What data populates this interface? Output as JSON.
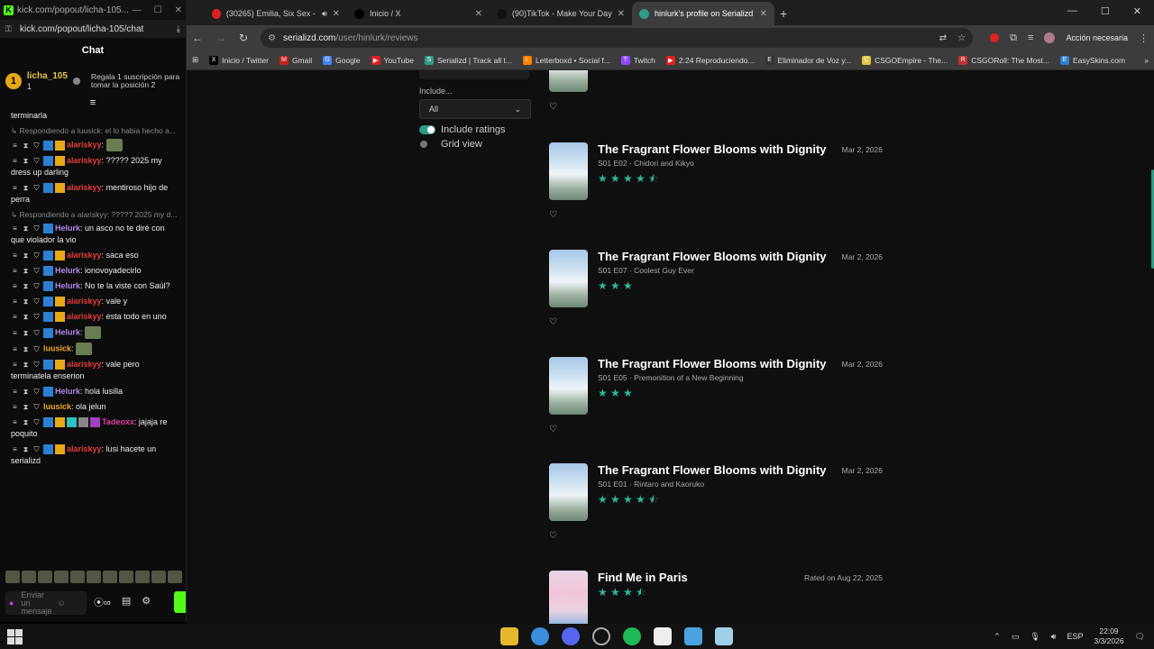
{
  "kick": {
    "window_title": "kick.com/popout/licha-105...",
    "url": "kick.com/popout/licha-105/chat",
    "chat_title": "Chat",
    "gift": {
      "rank": "1",
      "name": "licha_105",
      "count": "1",
      "message": "Regala 1 suscripción para tomar la posición 2"
    },
    "truncated_top": "terminarla",
    "messages": [
      {
        "reply": "Respondiendo a luusick: el lo habia hecho a...",
        "user": "alariskyy",
        "ucls": "u-red",
        "text": "",
        "emote": true,
        "badges": "full"
      },
      {
        "reply": "",
        "user": "alariskyy",
        "ucls": "u-red",
        "text": "????? 2025 my dress up darling",
        "badges": "full"
      },
      {
        "reply": "",
        "user": "alariskyy",
        "ucls": "u-red",
        "text": "mentiroso hijo de perra",
        "badges": "full"
      },
      {
        "reply": "Respondiendo a alariskyy: ????? 2025 my d...",
        "user": "Helurk",
        "ucls": "u-purp",
        "text": "un asco no te diré con que violador la vio",
        "badges": "blue"
      },
      {
        "reply": "",
        "user": "alariskyy",
        "ucls": "u-red",
        "text": "saca eso",
        "badges": "full"
      },
      {
        "reply": "",
        "user": "Helurk",
        "ucls": "u-purp",
        "text": "ionovoyadecirlo",
        "badges": "blue"
      },
      {
        "reply": "",
        "user": "Helurk",
        "ucls": "u-purp",
        "text": "No te la viste con Saúl?",
        "badges": "blue"
      },
      {
        "reply": "",
        "user": "alariskyy",
        "ucls": "u-red",
        "text": "vale y",
        "badges": "full"
      },
      {
        "reply": "",
        "user": "alariskyy",
        "ucls": "u-red",
        "text": "esta todo en uno",
        "badges": "full"
      },
      {
        "reply": "",
        "user": "Helurk",
        "ucls": "u-purp",
        "text": "",
        "emote": true,
        "badges": "blue"
      },
      {
        "reply": "",
        "user": "luusick",
        "ucls": "u-or",
        "text": "",
        "emote": true,
        "badges": "none"
      },
      {
        "reply": "",
        "user": "alariskyy",
        "ucls": "u-red",
        "text": "vale pero terminatela enserion",
        "badges": "full"
      },
      {
        "reply": "",
        "user": "Helurk",
        "ucls": "u-purp",
        "text": "hola lusilla",
        "badges": "blue"
      },
      {
        "reply": "",
        "user": "luusick",
        "ucls": "u-or",
        "text": "ola jelun",
        "badges": "none"
      },
      {
        "reply": "",
        "user": "Tadeoxx",
        "ucls": "u-pk",
        "text": "jajaja re poquito",
        "badges": "many"
      },
      {
        "reply": "",
        "user": "alariskyy",
        "ucls": "u-red",
        "text": "lusi hacete un serializd",
        "badges": "full"
      }
    ],
    "input_placeholder": "Enviar un mensaje"
  },
  "browser": {
    "tabs": [
      {
        "label": "(30265) Emilia, Six Sex - pa",
        "icon": "youtube-icon",
        "color": "#e02020"
      },
      {
        "label": "Inicio / X",
        "icon": "x-icon",
        "color": "#000000"
      },
      {
        "label": "(90)TikTok - Make Your Day",
        "icon": "tiktok-icon",
        "color": "#111111"
      },
      {
        "label": "hinlurk's profile on Serializd",
        "icon": "serializd-icon",
        "color": "#2e9c87"
      }
    ],
    "url_domain": "serializd.com",
    "url_path": "/user/hinlurk/reviews",
    "action_label": "Acción necesaria",
    "bookmarks": [
      {
        "label": "Inicio / Twitter",
        "color": "#000000",
        "g": "X"
      },
      {
        "label": "Gmail",
        "color": "#c5221f",
        "g": "M"
      },
      {
        "label": "Google",
        "color": "#4285f4",
        "g": "G"
      },
      {
        "label": "YouTube",
        "color": "#e02020",
        "g": "▶"
      },
      {
        "label": "Serializd | Track all t...",
        "color": "#2e9c87",
        "g": "S"
      },
      {
        "label": "Letterboxd • Social f...",
        "color": "#ff8000",
        "g": "L"
      },
      {
        "label": "Twitch",
        "color": "#9146ff",
        "g": "T"
      },
      {
        "label": "2:24 Reproduciendo...",
        "color": "#e02020",
        "g": "▶"
      },
      {
        "label": "Eliminador de Voz y...",
        "color": "#333333",
        "g": "E"
      },
      {
        "label": "CSGOEmpire - The...",
        "color": "#e6c347",
        "g": "C"
      },
      {
        "label": "CSGORoll: The Most...",
        "color": "#c03030",
        "g": "R"
      },
      {
        "label": "EasySkins.com",
        "color": "#2d7fd3",
        "g": "E"
      }
    ]
  },
  "serializd": {
    "include_label": "Include...",
    "include_value": "All",
    "toggle_ratings": "Include ratings",
    "toggle_grid": "Grid view",
    "reviews": [
      {
        "title": "",
        "subtitle": "",
        "date": "",
        "rating": 4.5,
        "partial": true
      },
      {
        "title": "The Fragrant Flower Blooms with Dignity",
        "subtitle": "S01 E02 · Chidori and Kikyo",
        "date": "Mar 2, 2026",
        "rating": 4.5
      },
      {
        "title": "The Fragrant Flower Blooms with Dignity",
        "subtitle": "S01 E07 · Coolest Guy Ever",
        "date": "Mar 2, 2026",
        "rating": 3
      },
      {
        "title": "The Fragrant Flower Blooms with Dignity",
        "subtitle": "S01 E05 · Premonition of a New Beginning",
        "date": "Mar 2, 2026",
        "rating": 3
      },
      {
        "title": "The Fragrant Flower Blooms with Dignity",
        "subtitle": "S01 E01 · Rintaro and Kaoruko",
        "date": "Mar 2, 2026",
        "rating": 4.5
      },
      {
        "title": "Find Me in Paris",
        "subtitle": "",
        "date": "Rated on Aug 22, 2025",
        "rating": 3.5,
        "paris": true
      }
    ]
  },
  "taskbar": {
    "lang": "ESP",
    "time": "22:09",
    "date": "3/3/2026"
  }
}
